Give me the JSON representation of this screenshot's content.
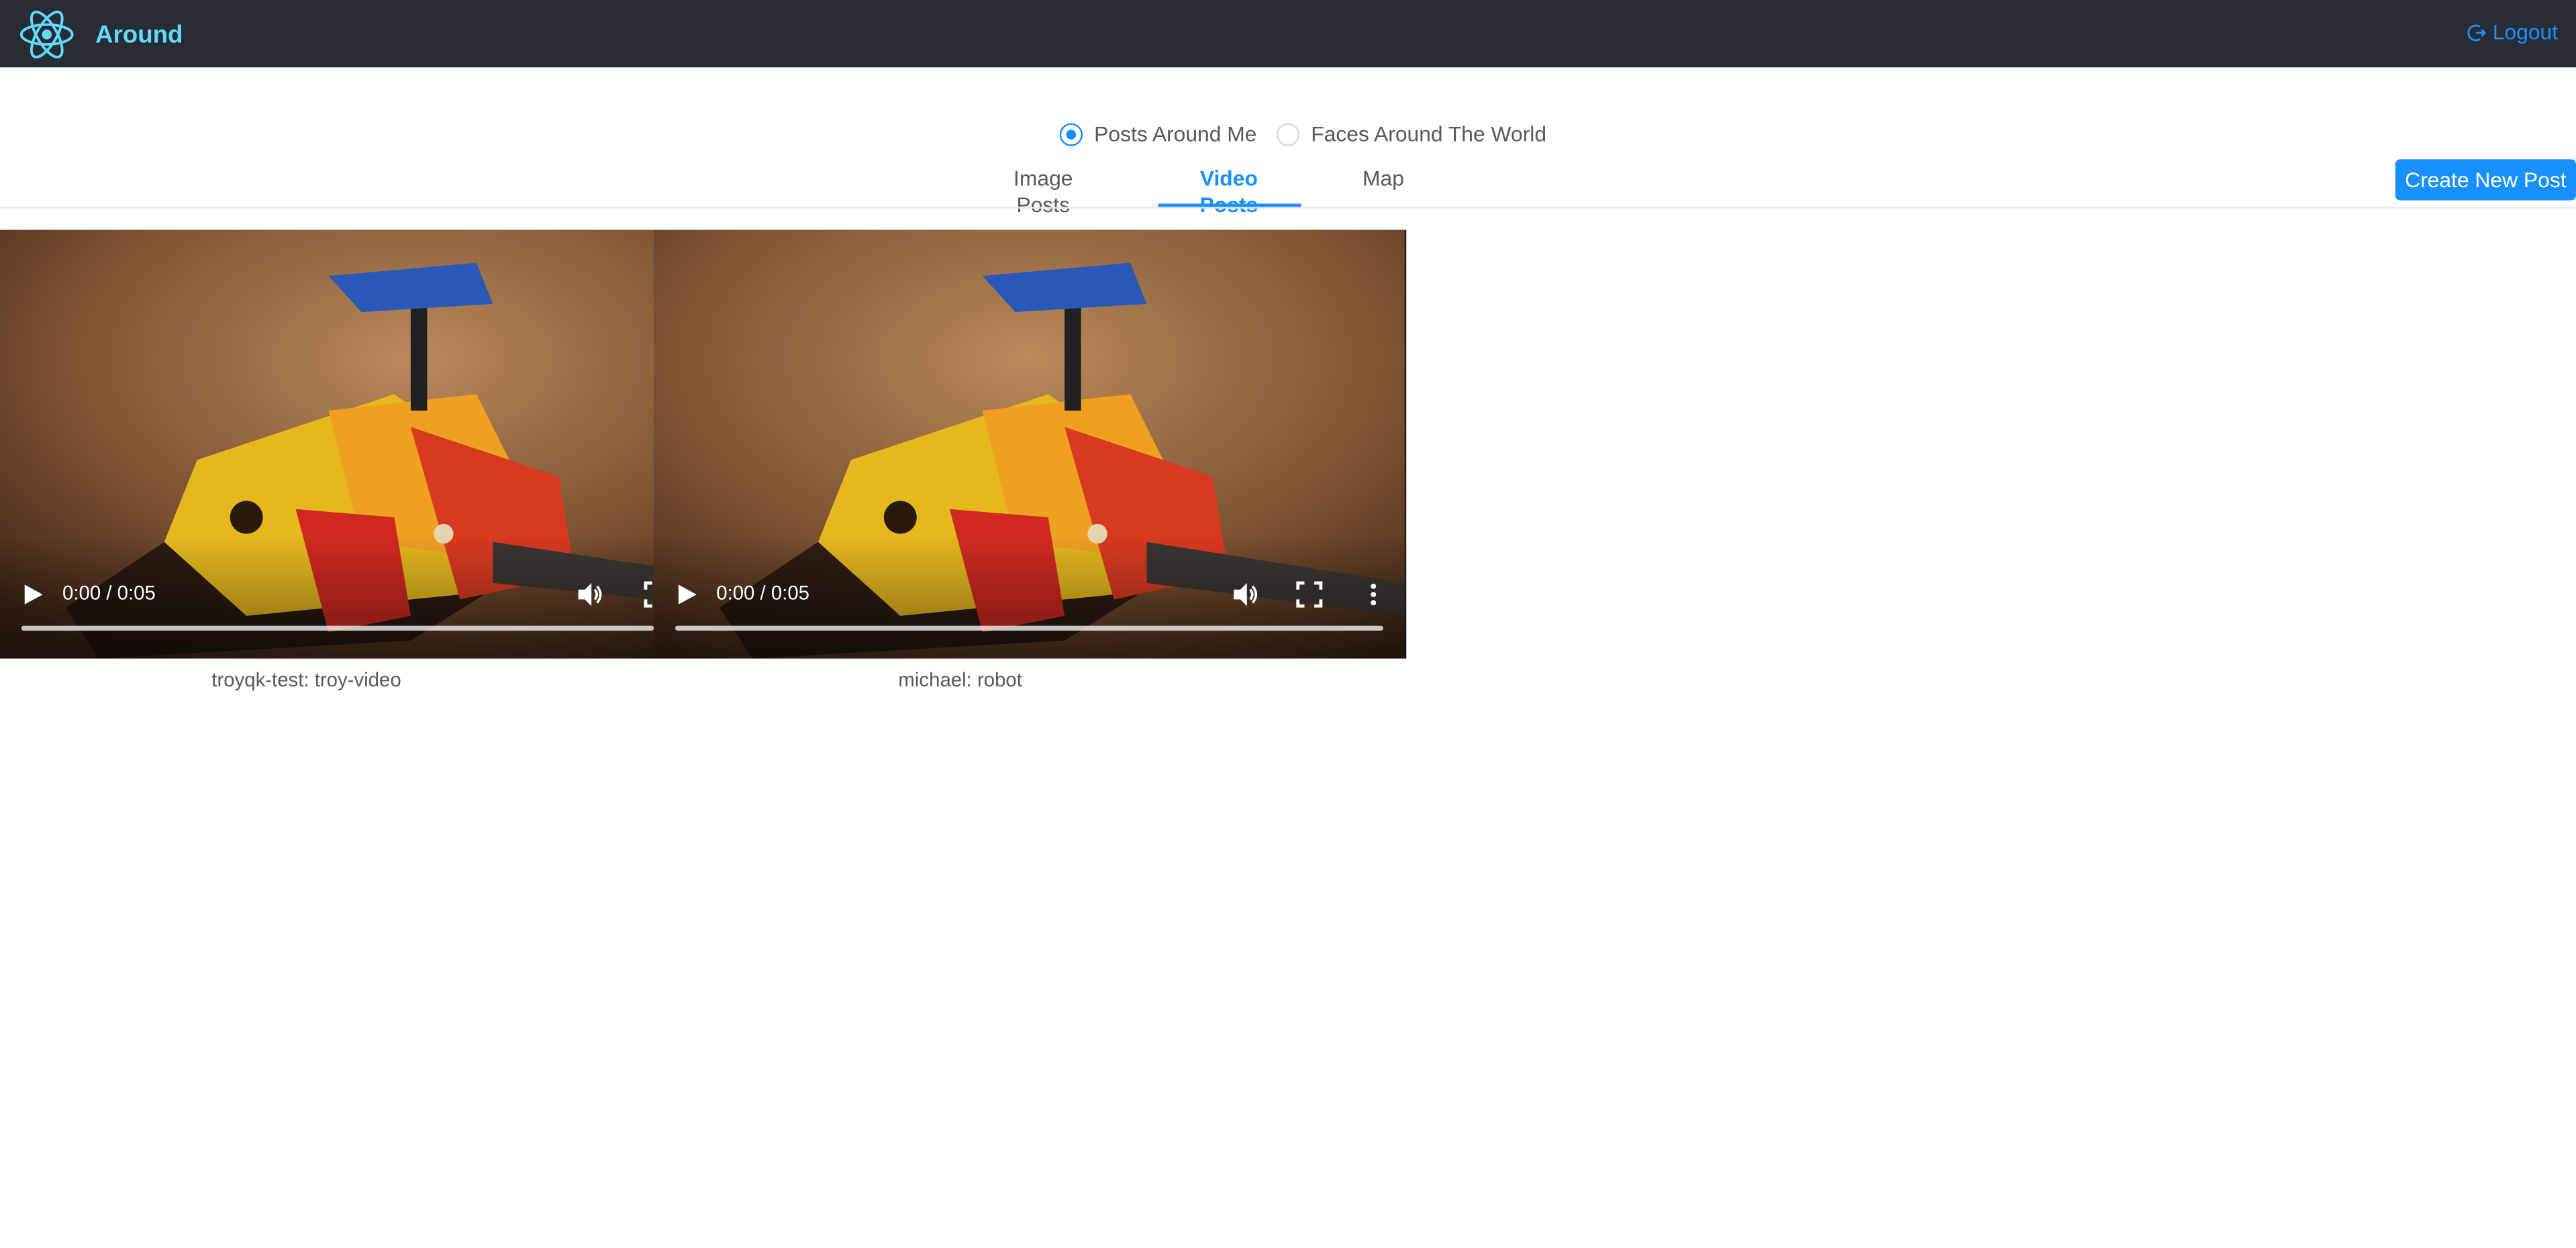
{
  "header": {
    "app_title": "Around",
    "logout_label": "Logout",
    "background": "#282c34",
    "brand_color": "#61dafb",
    "logo_icon": "react-atom-icon",
    "logout_icon": "logout-arrow-icon"
  },
  "filters": {
    "options": [
      {
        "label": "Posts Around Me",
        "checked": true
      },
      {
        "label": "Faces Around The World",
        "checked": false
      }
    ]
  },
  "tabs": [
    {
      "label": "Image Posts",
      "active": false
    },
    {
      "label": "Video Posts",
      "active": true
    },
    {
      "label": "Map",
      "active": false
    }
  ],
  "actions": {
    "create_post_label": "Create New Post",
    "accent": "#1890ff"
  },
  "videos": [
    {
      "time": "0:00 / 0:05",
      "caption": "troyqk-test: troy-video",
      "progress": 0
    },
    {
      "time": "0:00 / 0:05",
      "caption": "michael: robot",
      "progress": 0
    }
  ]
}
